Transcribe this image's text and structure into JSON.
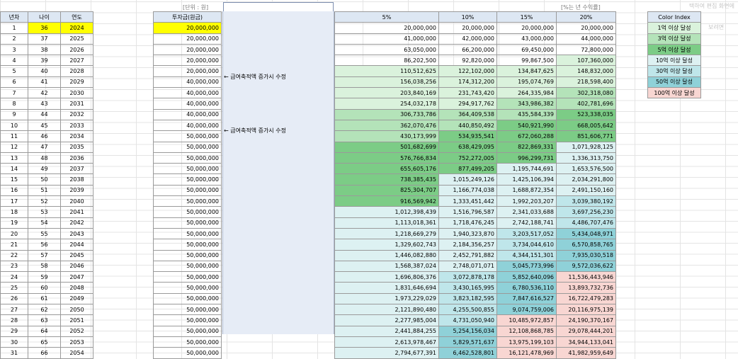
{
  "header": {
    "unit_label": "[단위 : 원]",
    "note_label": "[%는 년 수익률]"
  },
  "left_table": {
    "headers": [
      "년차",
      "나이",
      "연도"
    ],
    "rows": [
      [
        "1",
        "36",
        "2024"
      ],
      [
        "2",
        "37",
        "2025"
      ],
      [
        "3",
        "38",
        "2026"
      ],
      [
        "4",
        "39",
        "2027"
      ],
      [
        "5",
        "40",
        "2028"
      ],
      [
        "6",
        "41",
        "2029"
      ],
      [
        "7",
        "42",
        "2030"
      ],
      [
        "8",
        "43",
        "2031"
      ],
      [
        "9",
        "44",
        "2032"
      ],
      [
        "10",
        "45",
        "2033"
      ],
      [
        "11",
        "46",
        "2034"
      ],
      [
        "12",
        "47",
        "2035"
      ],
      [
        "13",
        "48",
        "2036"
      ],
      [
        "14",
        "49",
        "2037"
      ],
      [
        "15",
        "50",
        "2038"
      ],
      [
        "16",
        "51",
        "2039"
      ],
      [
        "17",
        "52",
        "2040"
      ],
      [
        "18",
        "53",
        "2041"
      ],
      [
        "19",
        "54",
        "2042"
      ],
      [
        "20",
        "55",
        "2043"
      ],
      [
        "21",
        "56",
        "2044"
      ],
      [
        "22",
        "57",
        "2045"
      ],
      [
        "23",
        "58",
        "2046"
      ],
      [
        "24",
        "59",
        "2047"
      ],
      [
        "25",
        "60",
        "2048"
      ],
      [
        "26",
        "61",
        "2049"
      ],
      [
        "27",
        "62",
        "2050"
      ],
      [
        "28",
        "63",
        "2051"
      ],
      [
        "29",
        "64",
        "2052"
      ],
      [
        "30",
        "65",
        "2053"
      ],
      [
        "31",
        "66",
        "2054"
      ]
    ]
  },
  "investment_table": {
    "header": "투자금(원금)",
    "values": [
      "20,000,000",
      "20,000,000",
      "20,000,000",
      "20,000,000",
      "20,000,000",
      "40,000,000",
      "40,000,000",
      "40,000,000",
      "40,000,000",
      "40,000,000",
      "50,000,000",
      "50,000,000",
      "50,000,000",
      "50,000,000",
      "50,000,000",
      "50,000,000",
      "50,000,000",
      "50,000,000",
      "50,000,000",
      "50,000,000",
      "50,000,000",
      "50,000,000",
      "50,000,000",
      "50,000,000",
      "50,000,000",
      "50,000,000",
      "50,000,000",
      "50,000,000",
      "50,000,000",
      "50,000,000",
      "50,000,000"
    ]
  },
  "annotations": {
    "note_1": "← 급여축적액 증가시 수정",
    "note_2": "← 급여축적액 증가시 수정"
  },
  "projection_table": {
    "headers": [
      "5%",
      "10%",
      "15%",
      "20%"
    ],
    "rows": [
      [
        "20,000,000",
        "20,000,000",
        "20,000,000",
        "20,000,000"
      ],
      [
        "41,000,000",
        "42,000,000",
        "43,000,000",
        "44,000,000"
      ],
      [
        "63,050,000",
        "66,200,000",
        "69,450,000",
        "72,800,000"
      ],
      [
        "86,202,500",
        "92,820,000",
        "99,867,500",
        "107,360,000"
      ],
      [
        "110,512,625",
        "122,102,000",
        "134,847,625",
        "148,832,000"
      ],
      [
        "156,038,256",
        "174,312,200",
        "195,074,769",
        "218,598,400"
      ],
      [
        "203,840,169",
        "231,743,420",
        "264,335,984",
        "302,318,080"
      ],
      [
        "254,032,178",
        "294,917,762",
        "343,986,382",
        "402,781,696"
      ],
      [
        "306,733,786",
        "364,409,538",
        "435,584,339",
        "523,338,035"
      ],
      [
        "362,070,476",
        "440,850,492",
        "540,921,990",
        "668,005,642"
      ],
      [
        "430,173,999",
        "534,935,541",
        "672,060,288",
        "851,606,771"
      ],
      [
        "501,682,699",
        "638,429,095",
        "822,869,331",
        "1,071,928,125"
      ],
      [
        "576,766,834",
        "752,272,005",
        "996,299,731",
        "1,336,313,750"
      ],
      [
        "655,605,176",
        "877,499,205",
        "1,195,744,691",
        "1,653,576,500"
      ],
      [
        "738,385,435",
        "1,015,249,126",
        "1,425,106,394",
        "2,034,291,800"
      ],
      [
        "825,304,707",
        "1,166,774,038",
        "1,688,872,354",
        "2,491,150,160"
      ],
      [
        "916,569,942",
        "1,333,451,442",
        "1,992,203,207",
        "3,039,380,192"
      ],
      [
        "1,012,398,439",
        "1,516,796,587",
        "2,341,033,688",
        "3,697,256,230"
      ],
      [
        "1,113,018,361",
        "1,718,476,245",
        "2,742,188,741",
        "4,486,707,476"
      ],
      [
        "1,218,669,279",
        "1,940,323,870",
        "3,203,517,052",
        "5,434,048,971"
      ],
      [
        "1,329,602,743",
        "2,184,356,257",
        "3,734,044,610",
        "6,570,858,765"
      ],
      [
        "1,446,082,880",
        "2,452,791,882",
        "4,344,151,301",
        "7,935,030,518"
      ],
      [
        "1,568,387,024",
        "2,748,071,071",
        "5,045,773,996",
        "9,572,036,622"
      ],
      [
        "1,696,806,376",
        "3,072,878,178",
        "5,852,640,096",
        "11,536,443,946"
      ],
      [
        "1,831,646,694",
        "3,430,165,995",
        "6,780,536,110",
        "13,893,732,736"
      ],
      [
        "1,973,229,029",
        "3,823,182,595",
        "7,847,616,527",
        "16,722,479,283"
      ],
      [
        "2,121,890,480",
        "4,255,500,855",
        "9,074,759,006",
        "20,116,975,139"
      ],
      [
        "2,277,985,004",
        "4,731,050,940",
        "10,485,972,857",
        "24,190,370,167"
      ],
      [
        "2,441,884,255",
        "5,254,156,034",
        "12,108,868,785",
        "29,078,444,201"
      ],
      [
        "2,613,978,467",
        "5,829,571,637",
        "13,975,199,103",
        "34,944,133,041"
      ],
      [
        "2,794,677,391",
        "6,462,528,801",
        "16,121,478,969",
        "41,982,959,649"
      ]
    ],
    "color_classes": [
      [
        "",
        "",
        "",
        ""
      ],
      [
        "",
        "",
        "",
        ""
      ],
      [
        "",
        "",
        "",
        ""
      ],
      [
        "",
        "",
        "",
        "c1"
      ],
      [
        "c1",
        "c1",
        "c1",
        "c1"
      ],
      [
        "c1",
        "c1",
        "c1",
        "c1"
      ],
      [
        "c1",
        "c1",
        "c1",
        "c3"
      ],
      [
        "c1",
        "c1",
        "c3",
        "c3"
      ],
      [
        "c3",
        "c3",
        "c3",
        "c5"
      ],
      [
        "c3",
        "c3",
        "c5",
        "c5"
      ],
      [
        "c3",
        "c5",
        "c5",
        "c5"
      ],
      [
        "c5",
        "c5",
        "c5",
        "c10"
      ],
      [
        "c5",
        "c5",
        "c5",
        "c10"
      ],
      [
        "c5",
        "c5",
        "c10",
        "c10"
      ],
      [
        "c5",
        "c10",
        "c10",
        "c10"
      ],
      [
        "c5",
        "c10",
        "c10",
        "c10"
      ],
      [
        "c5",
        "c10",
        "c10",
        "c30"
      ],
      [
        "c10",
        "c10",
        "c10",
        "c30"
      ],
      [
        "c10",
        "c10",
        "c10",
        "c30"
      ],
      [
        "c10",
        "c10",
        "c30",
        "c50"
      ],
      [
        "c10",
        "c10",
        "c30",
        "c50"
      ],
      [
        "c10",
        "c10",
        "c30",
        "c50"
      ],
      [
        "c10",
        "c10",
        "c50",
        "c50"
      ],
      [
        "c10",
        "c30",
        "c50",
        "c100"
      ],
      [
        "c10",
        "c30",
        "c50",
        "c100"
      ],
      [
        "c10",
        "c30",
        "c50",
        "c100"
      ],
      [
        "c10",
        "c30",
        "c50",
        "c100"
      ],
      [
        "c10",
        "c30",
        "c100",
        "c100"
      ],
      [
        "c10",
        "c50",
        "c100",
        "c100"
      ],
      [
        "c10",
        "c50",
        "c100",
        "c100"
      ],
      [
        "c10",
        "c50",
        "c100",
        "c100"
      ]
    ]
  },
  "legend": {
    "title": "Color Index",
    "items": [
      {
        "label": "1억 이상 달성",
        "class": "c1",
        "color": "#daf2dc"
      },
      {
        "label": "3억 이상 달성",
        "class": "c3",
        "color": "#b4e3b9"
      },
      {
        "label": "5억 이상 달성",
        "class": "c5",
        "color": "#7ccc86"
      },
      {
        "label": "10억 이상 달성",
        "class": "c10",
        "color": "#ddf1f2"
      },
      {
        "label": "30억 이상 달성",
        "class": "c30",
        "color": "#bfe6ea"
      },
      {
        "label": "50억 이상 달성",
        "class": "c50",
        "color": "#8fd1d8"
      },
      {
        "label": "100억 이상 달성",
        "class": "c100",
        "color": "#f8d6d2"
      }
    ]
  },
  "ghost_text": {
    "top": "택하여 편집 화면에",
    "mid": "보려면"
  },
  "colors": {
    "highlight_yellow": "#ffff00",
    "header_bg": "#dde7f3",
    "panel_bg": "#e6ecf6"
  }
}
